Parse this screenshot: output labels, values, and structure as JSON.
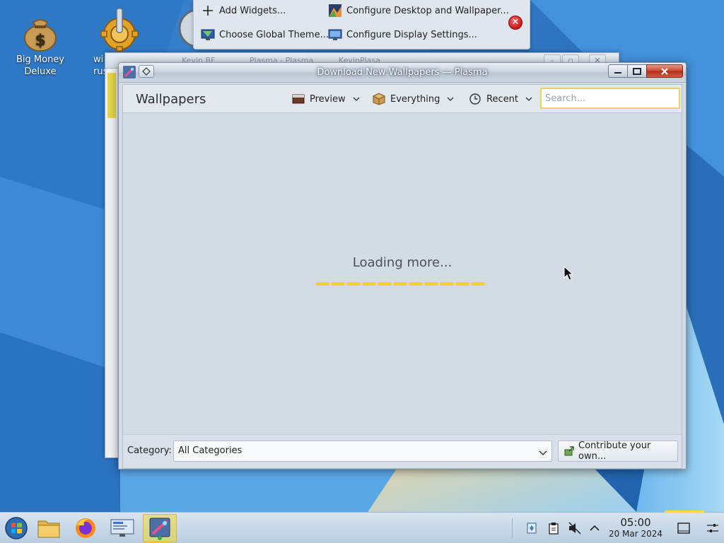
{
  "desktop": {
    "icons": [
      {
        "label": "Big Money\nDeluxe"
      },
      {
        "label": "wi\nruss"
      }
    ]
  },
  "desktop_popup": {
    "add_widgets": "Add Widgets...",
    "choose_global_theme": "Choose Global Theme...",
    "configure_desktop": "Configure Desktop and Wallpaper...",
    "configure_display": "Configure Display Settings..."
  },
  "background_window": {
    "tabs": [
      "Kevin BF",
      "Plasma - Plasma",
      "KevinPlasa"
    ]
  },
  "window": {
    "title": "Download New Wallpapers — Plasma",
    "header": {
      "page_title": "Wallpapers",
      "preview_label": "Preview",
      "everything_label": "Everything",
      "recent_label": "Recent",
      "search_placeholder": "Search..."
    },
    "content": {
      "loading_text": "Loading more...",
      "progress": 1.0
    },
    "footer": {
      "category_label": "Category:",
      "category_value": "All Categories",
      "contribute_label": "Contribute your own..."
    }
  },
  "taskbar": {
    "clock_time": "05:00",
    "clock_date": "20 Mar 2024"
  },
  "colors": {
    "accent": "#f0d22c",
    "close_red": "#c91515"
  }
}
